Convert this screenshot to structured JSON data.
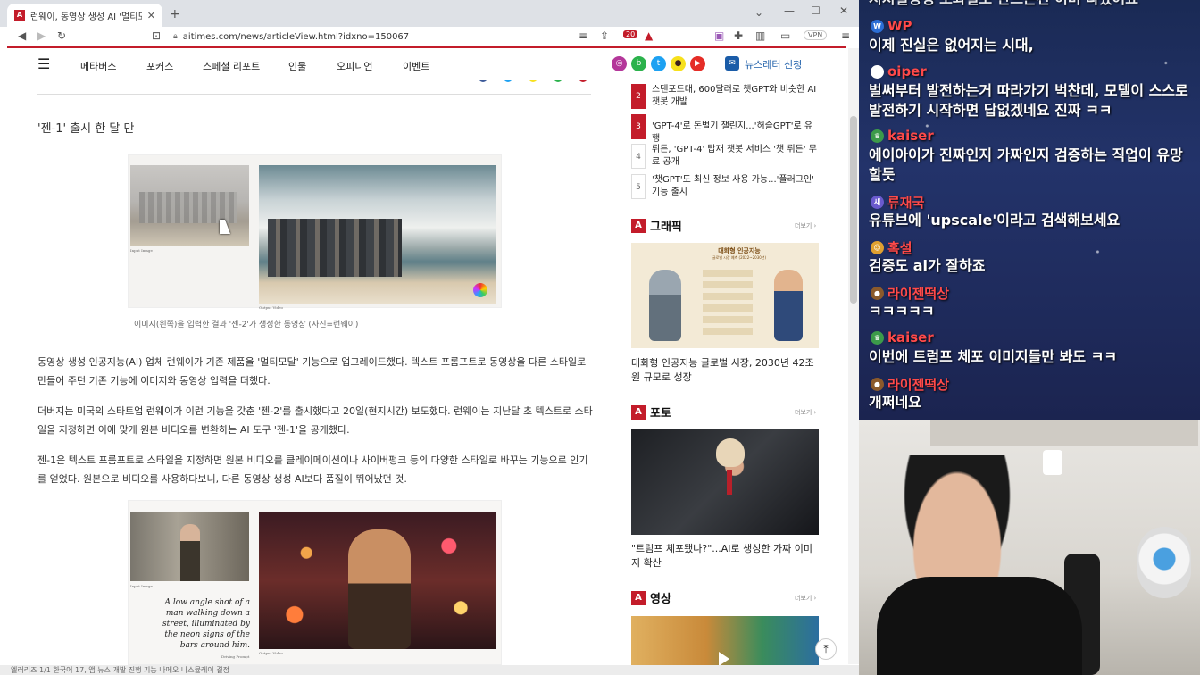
{
  "browser": {
    "tab_title": "런웨이, 동영상 생성 AI '멀티모달'",
    "url": "aitimes.com/news/articleView.html?idxno=150067",
    "ext_badge": "20",
    "vpn": "VPN"
  },
  "nav": {
    "items": [
      "메타버스",
      "포커스",
      "스페셜 리포트",
      "인물",
      "오피니언",
      "이벤트"
    ],
    "newsletter": "뉴스레터 신청"
  },
  "article": {
    "subheading": "'젠-1' 출시 한 달 만",
    "fig1": {
      "input_label": "Input Image",
      "output_label": "Output Video",
      "caption": "이미지(왼쪽)을 입력한 결과 '젠-2'가 생성한 동영상 (사진=런웨이)"
    },
    "paragraphs": [
      "동영상 생성 인공지능(AI) 업체 런웨이가 기존 제품을 '멀티모달' 기능으로 업그레이드했다. 텍스트 프롬프트로 동영상을 다른 스타일로 만들어 주던 기존 기능에 이미지와 동영상 입력을 더했다.",
      "더버지는 미국의 스타트업 런웨이가 이런 기능을 갖춘 '젠-2'를 출시했다고 20일(현지시간) 보도했다. 런웨이는 지난달 초 텍스트로 스타일을 지정하면 이에 맞게 원본 비디오를 변환하는 AI 도구 '젠-1'을 공개했다.",
      "젠-1은 텍스트 프롬프트로 스타일을 지정하면 원본 비디오를 클레이메이션이나 사이버펑크 등의 다양한 스타일로 바꾸는 기능으로 인기를 얻었다. 원본으로 비디오를 사용하다보니, 다른 동영상 생성 AI보다 품질이 뛰어났던 것."
    ],
    "fig2": {
      "input_label": "Input Image",
      "prompt_text": "A low angle shot of a man walking down a street, illuminated by the neon signs of the bars around him.",
      "prompt_label": "Driving Prompt",
      "output_label": "Output Video"
    }
  },
  "sidebar": {
    "ranks": [
      {
        "num": "2",
        "text": "스탠포드대, 600달러로 챗GPT와 비슷한 AI 챗봇 개발"
      },
      {
        "num": "3",
        "text": "'GPT-4'로 돈벌기 챌린지...'허슬GPT'로 유행"
      },
      {
        "num": "4",
        "text": "뤼튼, 'GPT-4' 탑재 챗봇 서비스 '챗 뤼튼' 무료 공개"
      },
      {
        "num": "5",
        "text": "'챗GPT'도 최신 정보 사용 가능...'플러그인' 기능 출시"
      }
    ],
    "graphic": {
      "title": "그래픽",
      "more": "더보기 ›",
      "img_title": "대화형 인공지능",
      "img_sub": "글로벌 시장 예측 (2022~2030년)",
      "caption": "대화형 인공지능 글로벌 시장, 2030년 42조원 규모로 성장"
    },
    "photo": {
      "title": "포토",
      "more": "더보기 ›",
      "caption": "\"트럼프 체포됐나?\"...AI로 생성한 가짜 이미지 확산"
    },
    "video": {
      "title": "영상",
      "more": "더보기 ›"
    }
  },
  "chat": [
    {
      "user": "",
      "msg": "지쳐설정생 도와일모 만드는건 이미 다셨어요",
      "color": "#ffffff"
    },
    {
      "user": "WP",
      "msg": "이제 진실은 없어지는 시대,",
      "color": "#ff4a4a"
    },
    {
      "user": "oiper",
      "msg": "벌써부터 발전하는거 따라가기 벅찬데, 모델이 스스로 발전하기 시작하면 답없겠네요 진짜 ㅋㅋ",
      "color": "#ff4a4a"
    },
    {
      "user": "kaiser",
      "msg": "에이아이가 진짜인지 가짜인지 검증하는 직업이 유망할듯",
      "color": "#ff4a4a"
    },
    {
      "user": "류재국",
      "msg": "유튜브에 'upscale'이라고 검색해보세요",
      "color": "#ff4a4a"
    },
    {
      "user": "혹설",
      "msg": "검증도 ai가 잘하죠",
      "color": "#ff4a4a"
    },
    {
      "user": "라이젠떡상",
      "msg": "ㅋㅋㅋㅋㅋ",
      "color": "#ff4a4a"
    },
    {
      "user": "kaiser",
      "msg": "이번에 트럼프 체포 이미지들만 봐도 ㅋㅋ",
      "color": "#ff4a4a"
    },
    {
      "user": "라이젠떡상",
      "msg": "개쩌네요",
      "color": "#ff4a4a"
    }
  ],
  "status_text": "엘러리즈 1/1   한국어   17, 앱 뉴스 개발 진행 기능        나메오   나스뮬레이 결정"
}
